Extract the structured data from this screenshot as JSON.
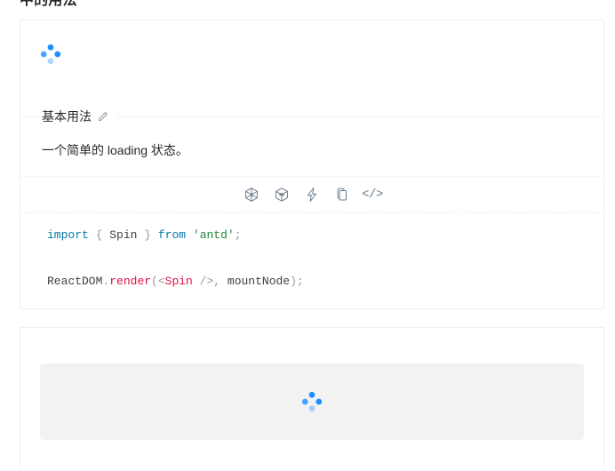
{
  "page": {
    "top_heading": "中的用法"
  },
  "demo_basic": {
    "title": "基本用法",
    "edit_icon": "edit-pencil-icon",
    "description": "一个简单的 loading 状态。",
    "spinner_icon": "loading-spinner-icon",
    "actions": [
      {
        "name": "codesandbox-icon",
        "glyph": "codesandbox"
      },
      {
        "name": "codepen-icon",
        "glyph": "codepen"
      },
      {
        "name": "stackblitz-icon",
        "glyph": "lightning"
      },
      {
        "name": "copy-icon",
        "glyph": "copy"
      },
      {
        "name": "show-code-icon",
        "glyph": "</>"
      }
    ],
    "code": {
      "line1": [
        {
          "t": "import",
          "c": "kw"
        },
        {
          "t": " ",
          "c": "plain"
        },
        {
          "t": "{",
          "c": "punc"
        },
        {
          "t": " Spin ",
          "c": "plain"
        },
        {
          "t": "}",
          "c": "punc"
        },
        {
          "t": " ",
          "c": "plain"
        },
        {
          "t": "from",
          "c": "kw"
        },
        {
          "t": " ",
          "c": "plain"
        },
        {
          "t": "'antd'",
          "c": "str"
        },
        {
          "t": ";",
          "c": "punc"
        }
      ],
      "line2": [
        {
          "t": "ReactDOM",
          "c": "plain"
        },
        {
          "t": ".",
          "c": "punc"
        },
        {
          "t": "render",
          "c": "fn"
        },
        {
          "t": "(",
          "c": "punc"
        },
        {
          "t": "<",
          "c": "punc"
        },
        {
          "t": "Spin",
          "c": "tag"
        },
        {
          "t": " ",
          "c": "plain"
        },
        {
          "t": "/>",
          "c": "punc"
        },
        {
          "t": ",",
          "c": "punc"
        },
        {
          "t": " mountNode",
          "c": "plain"
        },
        {
          "t": ")",
          "c": "punc"
        },
        {
          "t": ";",
          "c": "punc"
        }
      ]
    }
  },
  "demo_second": {
    "spinner_icon": "loading-spinner-icon",
    "panel_color": "#f2f2f2"
  },
  "colors": {
    "primary": "#1890ff",
    "border": "#f0f0f0",
    "icon": "#697b8c",
    "text": "rgba(0,0,0,0.85)"
  }
}
